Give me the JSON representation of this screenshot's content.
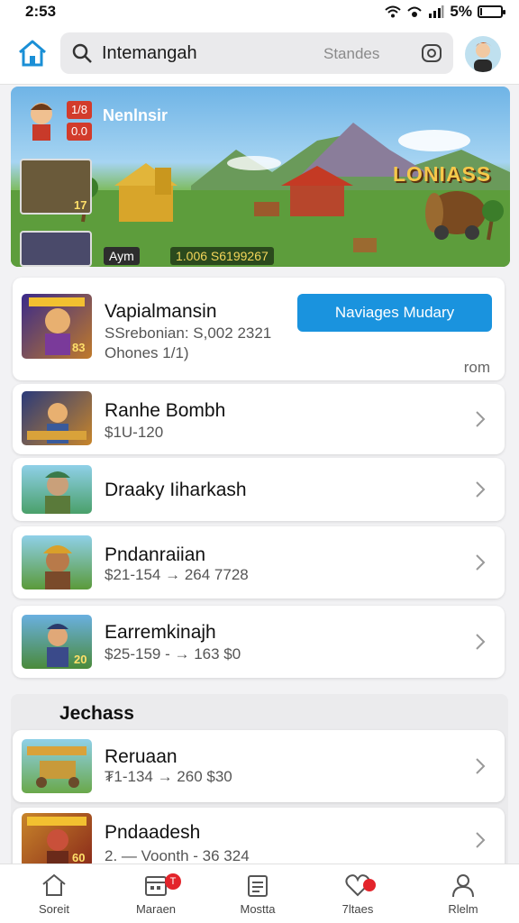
{
  "status_bar": {
    "time": "2:53",
    "battery": "5%",
    "battery_level": 0.05
  },
  "header": {
    "search_text": "Intemangah",
    "search_hint": "Standes"
  },
  "banner": {
    "title": "Nenlnsir",
    "brand": "LONIASS",
    "tags": [
      "Aym",
      "1.006 S6199267"
    ],
    "red_tags": [
      "1/8",
      "0.0"
    ],
    "thumb_counts": [
      "17"
    ]
  },
  "featured": {
    "title": "Vapialmansin",
    "line1": "SSrebonian: S,002 2321",
    "line2": "Ohones 1/1)",
    "cta_label": "Naviages Mudary",
    "foot": "rom",
    "icon_count": "83"
  },
  "list": [
    {
      "title": "Ranhe Bombh",
      "sub": "$1U-120"
    },
    {
      "title": "Draaky Iiharkash",
      "sub": ""
    },
    {
      "title": "Pndanraiian",
      "sub": "$21-154  → 264 7728"
    },
    {
      "title": "Earremkinajh",
      "sub": "$25-159 - → 163 $0",
      "icon_count": "20"
    }
  ],
  "section": {
    "title": "Jechass",
    "items": [
      {
        "title": "Reruaan",
        "sub": "₮1-134  → 260 $30"
      },
      {
        "title": "Pndaadesh",
        "sub": "2. — Voonth - 36 324",
        "icon_count": "60"
      }
    ]
  },
  "bottom_nav": [
    {
      "label": "Soreit",
      "icon": "home-icon"
    },
    {
      "label": "Maraen",
      "icon": "calendar-icon",
      "badge": "T"
    },
    {
      "label": "Mostta",
      "icon": "document-icon"
    },
    {
      "label": "7ltaes",
      "icon": "heart-icon",
      "dot": true
    },
    {
      "label": "Rlelm",
      "icon": "profile-icon"
    }
  ],
  "colors": {
    "accent": "#1a93de",
    "badge": "#e3242b",
    "home": "#1a8fd6"
  }
}
